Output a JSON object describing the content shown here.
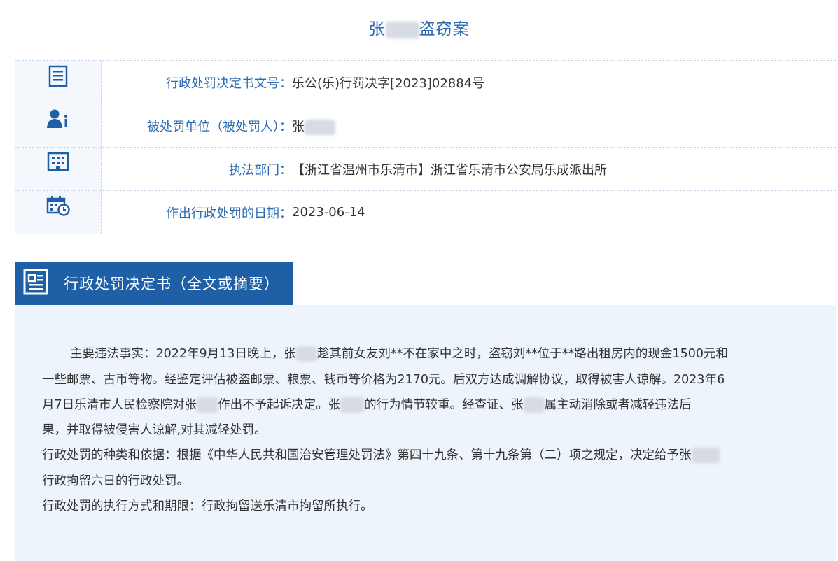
{
  "case_title": {
    "prefix": "张",
    "suffix": "盗窃案"
  },
  "info_rows": [
    {
      "icon": "document-number-icon",
      "label": "行政处罚决定书文号：",
      "value": "乐公(乐)行罚决字[2023]02884号"
    },
    {
      "icon": "person-info-icon",
      "label": "被处罚单位（被处罚人）：",
      "value": "张"
    },
    {
      "icon": "building-icon",
      "label": "执法部门：",
      "value": "【浙江省温州市乐清市】浙江省乐清市公安局乐成派出所"
    },
    {
      "icon": "calendar-clock-icon",
      "label": "作出行政处罚的日期：",
      "value": "2023-06-14"
    }
  ],
  "section": {
    "icon": "document-icon",
    "label": "行政处罚决定书（全文或摘要）"
  },
  "body": {
    "line1": "主要违法事实：2022年9月13日晚上，张",
    "line1b": "趁其前女友刘**不在家中之时，盗窃刘**位于**路出租房内的现金1500元和",
    "line2": "一些邮票、古币等物。经鉴定评估被盗邮票、粮票、钱币等价格为2170元。后双方达成调解协议，取得被害人谅解。2023年6",
    "line3a": "月7日乐清市人民检察院对张",
    "line3b": "作出不予起诉决定。张",
    "line3c": "的行为情节较重。经查证、张",
    "line3d": "属主动消除或者减轻违法后",
    "line4": "果，并取得被侵害人谅解,对其减轻处罚。",
    "line5": "行政处罚的种类和依据：根据《中华人民共和国治安管理处罚法》第四十九条、第十九条第（二）项之规定，决定给予张",
    "line6": "行政拘留六日的行政处罚。",
    "line7": "行政处罚的执行方式和期限：行政拘留送乐清市拘留所执行。"
  },
  "colors": {
    "accent": "#1e5fa5",
    "label": "#2a6bb3",
    "content_bg": "#eef4fb"
  }
}
